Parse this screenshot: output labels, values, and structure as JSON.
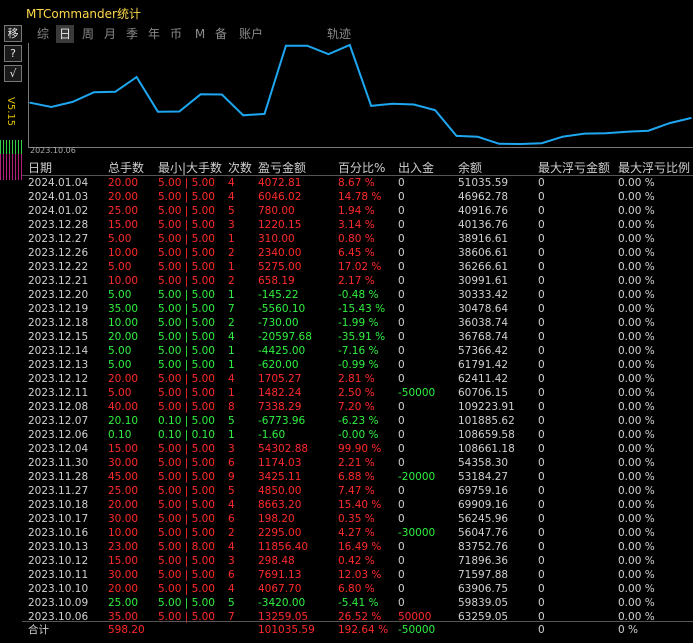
{
  "app": {
    "title": "MTCommander统计"
  },
  "side": {
    "move_label": "移",
    "btn2_label": "?",
    "btn3_label": "√",
    "vtext": "V5.15"
  },
  "tabs": [
    {
      "label": "综",
      "active": false
    },
    {
      "label": "日",
      "active": true
    },
    {
      "label": "周",
      "active": false
    },
    {
      "label": "月",
      "active": false
    },
    {
      "label": "季",
      "active": false
    },
    {
      "label": "年",
      "active": false
    },
    {
      "label": "币",
      "active": false
    },
    {
      "label": "M",
      "active": false
    },
    {
      "label": "备",
      "active": false
    },
    {
      "label": "账户",
      "active": false
    },
    {
      "label": "轨迹",
      "active": false
    }
  ],
  "chart": {
    "start_label": "2023.10.06",
    "line_color": "#1ea7f0"
  },
  "chart_data": {
    "type": "line",
    "series": [
      {
        "values": [
          63259.05,
          59839.05,
          63906.75,
          71597.88,
          71896.36,
          83752.76,
          56047.76,
          56245.96,
          69909.16,
          69759.16,
          53184.27,
          54358.3,
          108661.18,
          108659.58,
          101885.62,
          109223.91,
          60706.15,
          62411.42,
          61791.42,
          57366.42,
          36768.74,
          36038.74,
          30478.64,
          30333.42,
          30991.61,
          36266.61,
          38606.61,
          38916.61,
          40136.76,
          40916.76,
          46962.78,
          51035.59
        ]
      }
    ]
  },
  "headers": [
    "日期",
    "总手数",
    "最小|大手数",
    "次数",
    "盈亏金额",
    "百分比%",
    "出入金",
    "余额",
    "最大浮亏金额",
    "最大浮亏比例"
  ],
  "rows": [
    {
      "date": "2024.01.04",
      "lots": "20.00",
      "minmax": "5.00 | 5.00",
      "count": "4",
      "pnl": "4072.81",
      "pct": "8.67 %",
      "io": "0",
      "bal": "51035.59",
      "maxdd": "0",
      "ddpct": "0.00 %",
      "s": "red"
    },
    {
      "date": "2024.01.03",
      "lots": "20.00",
      "minmax": "5.00 | 5.00",
      "count": "4",
      "pnl": "6046.02",
      "pct": "14.78 %",
      "io": "0",
      "bal": "46962.78",
      "maxdd": "0",
      "ddpct": "0.00 %",
      "s": "red"
    },
    {
      "date": "2024.01.02",
      "lots": "25.00",
      "minmax": "5.00 | 5.00",
      "count": "5",
      "pnl": "780.00",
      "pct": "1.94 %",
      "io": "0",
      "bal": "40916.76",
      "maxdd": "0",
      "ddpct": "0.00 %",
      "s": "red"
    },
    {
      "date": "2023.12.28",
      "lots": "15.00",
      "minmax": "5.00 | 5.00",
      "count": "3",
      "pnl": "1220.15",
      "pct": "3.14 %",
      "io": "0",
      "bal": "40136.76",
      "maxdd": "0",
      "ddpct": "0.00 %",
      "s": "red"
    },
    {
      "date": "2023.12.27",
      "lots": "5.00",
      "minmax": "5.00 | 5.00",
      "count": "1",
      "pnl": "310.00",
      "pct": "0.80 %",
      "io": "0",
      "bal": "38916.61",
      "maxdd": "0",
      "ddpct": "0.00 %",
      "s": "red"
    },
    {
      "date": "2023.12.26",
      "lots": "10.00",
      "minmax": "5.00 | 5.00",
      "count": "2",
      "pnl": "2340.00",
      "pct": "6.45 %",
      "io": "0",
      "bal": "38606.61",
      "maxdd": "0",
      "ddpct": "0.00 %",
      "s": "red"
    },
    {
      "date": "2023.12.22",
      "lots": "5.00",
      "minmax": "5.00 | 5.00",
      "count": "1",
      "pnl": "5275.00",
      "pct": "17.02 %",
      "io": "0",
      "bal": "36266.61",
      "maxdd": "0",
      "ddpct": "0.00 %",
      "s": "red"
    },
    {
      "date": "2023.12.21",
      "lots": "10.00",
      "minmax": "5.00 | 5.00",
      "count": "2",
      "pnl": "658.19",
      "pct": "2.17 %",
      "io": "0",
      "bal": "30991.61",
      "maxdd": "0",
      "ddpct": "0.00 %",
      "s": "red"
    },
    {
      "date": "2023.12.20",
      "lots": "5.00",
      "minmax": "5.00 | 5.00",
      "count": "1",
      "pnl": "-145.22",
      "pct": "-0.48 %",
      "io": "0",
      "bal": "30333.42",
      "maxdd": "0",
      "ddpct": "0.00 %",
      "s": "grn"
    },
    {
      "date": "2023.12.19",
      "lots": "35.00",
      "minmax": "5.00 | 5.00",
      "count": "7",
      "pnl": "-5560.10",
      "pct": "-15.43 %",
      "io": "0",
      "bal": "30478.64",
      "maxdd": "0",
      "ddpct": "0.00 %",
      "s": "grn"
    },
    {
      "date": "2023.12.18",
      "lots": "10.00",
      "minmax": "5.00 | 5.00",
      "count": "2",
      "pnl": "-730.00",
      "pct": "-1.99 %",
      "io": "0",
      "bal": "36038.74",
      "maxdd": "0",
      "ddpct": "0.00 %",
      "s": "grn"
    },
    {
      "date": "2023.12.15",
      "lots": "20.00",
      "minmax": "5.00 | 5.00",
      "count": "4",
      "pnl": "-20597.68",
      "pct": "-35.91 %",
      "io": "0",
      "bal": "36768.74",
      "maxdd": "0",
      "ddpct": "0.00 %",
      "s": "grn"
    },
    {
      "date": "2023.12.14",
      "lots": "5.00",
      "minmax": "5.00 | 5.00",
      "count": "1",
      "pnl": "-4425.00",
      "pct": "-7.16 %",
      "io": "0",
      "bal": "57366.42",
      "maxdd": "0",
      "ddpct": "0.00 %",
      "s": "grn"
    },
    {
      "date": "2023.12.13",
      "lots": "5.00",
      "minmax": "5.00 | 5.00",
      "count": "1",
      "pnl": "-620.00",
      "pct": "-0.99 %",
      "io": "0",
      "bal": "61791.42",
      "maxdd": "0",
      "ddpct": "0.00 %",
      "s": "grn"
    },
    {
      "date": "2023.12.12",
      "lots": "20.00",
      "minmax": "5.00 | 5.00",
      "count": "4",
      "pnl": "1705.27",
      "pct": "2.81 %",
      "io": "0",
      "bal": "62411.42",
      "maxdd": "0",
      "ddpct": "0.00 %",
      "s": "red"
    },
    {
      "date": "2023.12.11",
      "lots": "5.00",
      "minmax": "5.00 | 5.00",
      "count": "1",
      "pnl": "1482.24",
      "pct": "2.50 %",
      "io": "-50000",
      "bal": "60706.15",
      "maxdd": "0",
      "ddpct": "0.00 %",
      "s": "red",
      "ios": "grn"
    },
    {
      "date": "2023.12.08",
      "lots": "40.00",
      "minmax": "5.00 | 5.00",
      "count": "8",
      "pnl": "7338.29",
      "pct": "7.20 %",
      "io": "0",
      "bal": "109223.91",
      "maxdd": "0",
      "ddpct": "0.00 %",
      "s": "red"
    },
    {
      "date": "2023.12.07",
      "lots": "20.10",
      "minmax": "0.10 | 5.00",
      "count": "5",
      "pnl": "-6773.96",
      "pct": "-6.23 %",
      "io": "0",
      "bal": "101885.62",
      "maxdd": "0",
      "ddpct": "0.00 %",
      "s": "grn"
    },
    {
      "date": "2023.12.06",
      "lots": "0.10",
      "minmax": "0.10 | 0.10",
      "count": "1",
      "pnl": "-1.60",
      "pct": "-0.00 %",
      "io": "0",
      "bal": "108659.58",
      "maxdd": "0",
      "ddpct": "0.00 %",
      "s": "grn"
    },
    {
      "date": "2023.12.04",
      "lots": "15.00",
      "minmax": "5.00 | 5.00",
      "count": "3",
      "pnl": "54302.88",
      "pct": "99.90 %",
      "io": "0",
      "bal": "108661.18",
      "maxdd": "0",
      "ddpct": "0.00 %",
      "s": "red"
    },
    {
      "date": "2023.11.30",
      "lots": "30.00",
      "minmax": "5.00 | 5.00",
      "count": "6",
      "pnl": "1174.03",
      "pct": "2.21 %",
      "io": "0",
      "bal": "54358.30",
      "maxdd": "0",
      "ddpct": "0.00 %",
      "s": "red"
    },
    {
      "date": "2023.11.28",
      "lots": "45.00",
      "minmax": "5.00 | 5.00",
      "count": "9",
      "pnl": "3425.11",
      "pct": "6.88 %",
      "io": "-20000",
      "bal": "53184.27",
      "maxdd": "0",
      "ddpct": "0.00 %",
      "s": "red",
      "ios": "grn"
    },
    {
      "date": "2023.11.27",
      "lots": "25.00",
      "minmax": "5.00 | 5.00",
      "count": "5",
      "pnl": "4850.00",
      "pct": "7.47 %",
      "io": "0",
      "bal": "69759.16",
      "maxdd": "0",
      "ddpct": "0.00 %",
      "s": "red"
    },
    {
      "date": "2023.10.18",
      "lots": "20.00",
      "minmax": "5.00 | 5.00",
      "count": "4",
      "pnl": "8663.20",
      "pct": "15.40 %",
      "io": "0",
      "bal": "69909.16",
      "maxdd": "0",
      "ddpct": "0.00 %",
      "s": "red"
    },
    {
      "date": "2023.10.17",
      "lots": "30.00",
      "minmax": "5.00 | 5.00",
      "count": "6",
      "pnl": "198.20",
      "pct": "0.35 %",
      "io": "0",
      "bal": "56245.96",
      "maxdd": "0",
      "ddpct": "0.00 %",
      "s": "red"
    },
    {
      "date": "2023.10.16",
      "lots": "10.00",
      "minmax": "5.00 | 5.00",
      "count": "2",
      "pnl": "2295.00",
      "pct": "4.27 %",
      "io": "-30000",
      "bal": "56047.76",
      "maxdd": "0",
      "ddpct": "0.00 %",
      "s": "red",
      "ios": "grn"
    },
    {
      "date": "2023.10.13",
      "lots": "23.00",
      "minmax": "5.00 | 8.00",
      "count": "4",
      "pnl": "11856.40",
      "pct": "16.49 %",
      "io": "0",
      "bal": "83752.76",
      "maxdd": "0",
      "ddpct": "0.00 %",
      "s": "red"
    },
    {
      "date": "2023.10.12",
      "lots": "15.00",
      "minmax": "5.00 | 5.00",
      "count": "3",
      "pnl": "298.48",
      "pct": "0.42 %",
      "io": "0",
      "bal": "71896.36",
      "maxdd": "0",
      "ddpct": "0.00 %",
      "s": "red"
    },
    {
      "date": "2023.10.11",
      "lots": "30.00",
      "minmax": "5.00 | 5.00",
      "count": "6",
      "pnl": "7691.13",
      "pct": "12.03 %",
      "io": "0",
      "bal": "71597.88",
      "maxdd": "0",
      "ddpct": "0.00 %",
      "s": "red"
    },
    {
      "date": "2023.10.10",
      "lots": "20.00",
      "minmax": "5.00 | 5.00",
      "count": "4",
      "pnl": "4067.70",
      "pct": "6.80 %",
      "io": "0",
      "bal": "63906.75",
      "maxdd": "0",
      "ddpct": "0.00 %",
      "s": "red"
    },
    {
      "date": "2023.10.09",
      "lots": "25.00",
      "minmax": "5.00 | 5.00",
      "count": "5",
      "pnl": "-3420.00",
      "pct": "-5.41 %",
      "io": "0",
      "bal": "59839.05",
      "maxdd": "0",
      "ddpct": "0.00 %",
      "s": "grn"
    },
    {
      "date": "2023.10.06",
      "lots": "35.00",
      "minmax": "5.00 | 5.00",
      "count": "7",
      "pnl": "13259.05",
      "pct": "26.52 %",
      "io": "50000",
      "bal": "63259.05",
      "maxdd": "0",
      "ddpct": "0.00 %",
      "s": "red",
      "ios": "red"
    }
  ],
  "total": {
    "label": "合计",
    "lots": "598.20",
    "pnl": "101035.59",
    "pct": "192.64 %",
    "io": "-50000",
    "maxdd": "0",
    "ddpct": "0 %"
  }
}
